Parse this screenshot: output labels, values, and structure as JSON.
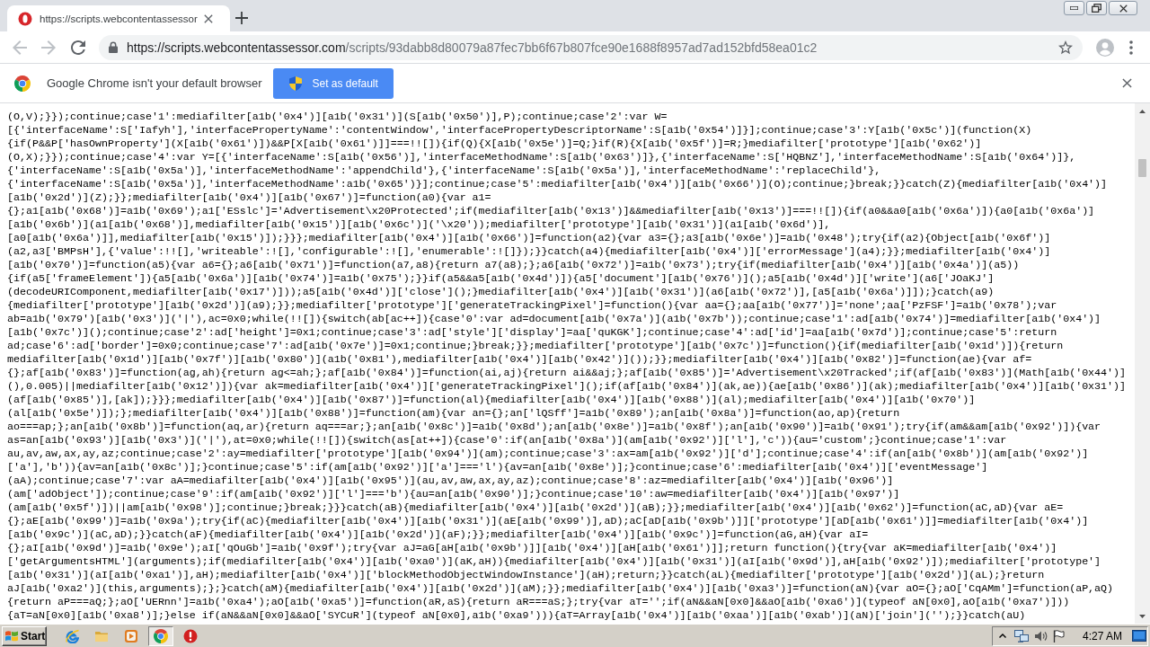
{
  "tabs": [
    {
      "title": "https://scripts.webcontentassessor",
      "selected": true
    }
  ],
  "toolbar": {
    "back": {
      "disabled": true
    },
    "forward": {
      "disabled": true
    },
    "url_host": "https://scripts.webcontentassessor.com",
    "url_path": "/scripts/93dabb8d80079a87fec7bb6f67b807fce90e1688f8957ad7ad152bfd58ea01c2"
  },
  "infobar": {
    "message": "Google Chrome isn't your default browser",
    "button": "Set as default"
  },
  "code_lines": [
    "(O,V);}});continue;case'1':mediafilter[a1b('0x4')][a1b('0x31')](S[a1b('0x50')],P);continue;case'2':var W=",
    "[{'interfaceName':S['Iafyh'],'interfacePropertyName':'contentWindow','interfacePropertyDescriptorName':S[a1b('0x54')]}];continue;case'3':Y[a1b('0x5c')](function(X)",
    "{if(P&&P['hasOwnProperty'](X[a1b('0x61')])&&P[X[a1b('0x61')]]===!![]){if(Q){X[a1b('0x5e')]=Q;}if(R){X[a1b('0x5f')]=R;}mediafilter['prototype'][a1b('0x62')]",
    "(O,X);}});continue;case'4':var Y=[{'interfaceName':S[a1b('0x56')],'interfaceMethodName':S[a1b('0x63')]},{'interfaceName':S['HQBNZ'],'interfaceMethodName':S[a1b('0x64')]},",
    "{'interfaceName':S[a1b('0x5a')],'interfaceMethodName':'appendChild'},{'interfaceName':S[a1b('0x5a')],'interfaceMethodName':'replaceChild'},",
    "{'interfaceName':S[a1b('0x5a')],'interfaceMethodName':a1b('0x65')}];continue;case'5':mediafilter[a1b('0x4')][a1b('0x66')](O);continue;}break;}}catch(Z){mediafilter[a1b('0x4')]",
    "[a1b('0x2d')](Z);}};mediafilter[a1b('0x4')][a1b('0x67')]=function(a0){var a1=",
    "{};a1[a1b('0x68')]=a1b('0x69');a1['ESslc']='Advertisement\\x20Protected';if(mediafilter[a1b('0x13')]&&mediafilter[a1b('0x13')]===!![]){if(a0&&a0[a1b('0x6a')]){a0[a1b('0x6a')]",
    "[a1b('0x6b')](a1[a1b('0x68')],mediafilter[a1b('0x15')][a1b('0x6c')]('\\x20'));mediafilter['prototype'][a1b('0x31')](a1[a1b('0x6d')],",
    "[a0[a1b('0x6a')]],mediafilter[a1b('0x15')]);}}};mediafilter[a1b('0x4')][a1b('0x66')]=function(a2){var a3={};a3[a1b('0x6e')]=a1b('0x48');try{if(a2){Object[a1b('0x6f')]",
    "(a2,a3['BMPsH'],{'value':!![],'writeable':![],'configurable':![],'enumerable':![]});}}catch(a4){mediafilter[a1b('0x4')]['errorMessage'](a4);}};mediafilter[a1b('0x4')]",
    "[a1b('0x70')]=function(a5){var a6={};a6[a1b('0x71')]=function(a7,a8){return a7(a8);};a6[a1b('0x72')]=a1b('0x73');try{if(mediafilter[a1b('0x4')][a1b('0x4a')](a5))",
    "{if(a5['frameElement']){a5[a1b('0x6a')][a1b('0x74')]=a1b('0x75');}}if(a5&&a5[a1b('0x4d')]){a5['document'][a1b('0x76')]();a5[a1b('0x4d')]['write'](a6['JOaKJ']",
    "(decodeURIComponent,mediafilter[a1b('0x17')]));a5[a1b('0x4d')]['close']();}mediafilter[a1b('0x4')][a1b('0x31')](a6[a1b('0x72')],[a5[a1b('0x6a')]]);}catch(a9)",
    "{mediafilter['prototype'][a1b('0x2d')](a9);}};mediafilter['prototype']['generateTrackingPixel']=function(){var aa={};aa[a1b('0x77')]='none';aa['PzFSF']=a1b('0x78');var",
    "ab=a1b('0x79')[a1b('0x3')]('|'),ac=0x0;while(!![]){switch(ab[ac++]){case'0':var ad=document[a1b('0x7a')](a1b('0x7b'));continue;case'1':ad[a1b('0x74')]=mediafilter[a1b('0x4')]",
    "[a1b('0x7c')]();continue;case'2':ad['height']=0x1;continue;case'3':ad['style']['display']=aa['quKGK'];continue;case'4':ad['id']=aa[a1b('0x7d')];continue;case'5':return",
    "ad;case'6':ad['border']=0x0;continue;case'7':ad[a1b('0x7e')]=0x1;continue;}break;}};mediafilter['prototype'][a1b('0x7c')]=function(){if(mediafilter[a1b('0x1d')]){return",
    "mediafilter[a1b('0x1d')][a1b('0x7f')][a1b('0x80')](a1b('0x81'),mediafilter[a1b('0x4')][a1b('0x42')]());}};mediafilter[a1b('0x4')][a1b('0x82')]=function(ae){var af=",
    "{};af[a1b('0x83')]=function(ag,ah){return ag<=ah;};af[a1b('0x84')]=function(ai,aj){return ai&&aj;};af[a1b('0x85')]='Advertisement\\x20Tracked';if(af[a1b('0x83')](Math[a1b('0x44')]",
    "(),0.005)||mediafilter[a1b('0x12')]){var ak=mediafilter[a1b('0x4')]['generateTrackingPixel']();if(af[a1b('0x84')](ak,ae)){ae[a1b('0x86')](ak);mediafilter[a1b('0x4')][a1b('0x31')]",
    "(af[a1b('0x85')],[ak]);}}};mediafilter[a1b('0x4')][a1b('0x87')]=function(al){mediafilter[a1b('0x4')][a1b('0x88')](al);mediafilter[a1b('0x4')][a1b('0x70')]",
    "(al[a1b('0x5e')]);};mediafilter[a1b('0x4')][a1b('0x88')]=function(am){var an={};an['lQSff']=a1b('0x89');an[a1b('0x8a')]=function(ao,ap){return",
    "ao===ap;};an[a1b('0x8b')]=function(aq,ar){return aq===ar;};an[a1b('0x8c')]=a1b('0x8d');an[a1b('0x8e')]=a1b('0x8f');an[a1b('0x90')]=a1b('0x91');try{if(am&&am[a1b('0x92')]){var",
    "as=an[a1b('0x93')][a1b('0x3')]('|'),at=0x0;while(!![]){switch(as[at++]){case'0':if(an[a1b('0x8a')](am[a1b('0x92')]['l'],'c')){au='custom';}continue;case'1':var",
    "au,av,aw,ax,ay,az;continue;case'2':ay=mediafilter['prototype'][a1b('0x94')](am);continue;case'3':ax=am[a1b('0x92')]['d'];continue;case'4':if(an[a1b('0x8b')](am[a1b('0x92')]",
    "['a'],'b')){av=an[a1b('0x8c')];}continue;case'5':if(am[a1b('0x92')]['a']==='l'){av=an[a1b('0x8e')];}continue;case'6':mediafilter[a1b('0x4')]['eventMessage']",
    "(aA);continue;case'7':var aA=mediafilter[a1b('0x4')][a1b('0x95')](au,av,aw,ax,ay,az);continue;case'8':az=mediafilter[a1b('0x4')][a1b('0x96')]",
    "(am['adObject']);continue;case'9':if(am[a1b('0x92')]['l']==='b'){au=an[a1b('0x90')];}continue;case'10':aw=mediafilter[a1b('0x4')][a1b('0x97')]",
    "(am[a1b('0x5f')])||am[a1b('0x98')];continue;}break;}}}catch(aB){mediafilter[a1b('0x4')][a1b('0x2d')](aB);}};mediafilter[a1b('0x4')][a1b('0x62')]=function(aC,aD){var aE=",
    "{};aE[a1b('0x99')]=a1b('0x9a');try{if(aC){mediafilter[a1b('0x4')][a1b('0x31')](aE[a1b('0x99')],aD);aC[aD[a1b('0x9b')]]['prototype'][aD[a1b('0x61')]]=mediafilter[a1b('0x4')]",
    "[a1b('0x9c')](aC,aD);}}catch(aF){mediafilter[a1b('0x4')][a1b('0x2d')](aF);}};mediafilter[a1b('0x4')][a1b('0x9c')]=function(aG,aH){var aI=",
    "{};aI[a1b('0x9d')]=a1b('0x9e');aI['qOuGb']=a1b('0x9f');try{var aJ=aG[aH[a1b('0x9b')]][a1b('0x4')][aH[a1b('0x61')]];return function(){try{var aK=mediafilter[a1b('0x4')]",
    "['getArgumentsHTML'](arguments);if(mediafilter[a1b('0x4')][a1b('0xa0')](aK,aH)){mediafilter[a1b('0x4')][a1b('0x31')](aI[a1b('0x9d')],aH[a1b('0x92')]);mediafilter['prototype']",
    "[a1b('0x31')](aI[a1b('0xa1')],aH);mediafilter[a1b('0x4')]['blockMethodObjectWindowInstance'](aH);return;}}catch(aL){mediafilter['prototype'][a1b('0x2d')](aL);}return",
    "aJ[a1b('0xa2')](this,arguments);};}catch(aM){mediafilter[a1b('0x4')][a1b('0x2d')](aM);}};mediafilter[a1b('0x4')][a1b('0xa3')]=function(aN){var aO={};aO['CqAMm']=function(aP,aQ)",
    "{return aP===aQ;};aO['UERnn']=a1b('0xa4');aO[a1b('0xa5')]=function(aR,aS){return aR===aS;};try{var aT='';if(aN&&aN[0x0]&&aO[a1b('0xa6')](typeof aN[0x0],aO[a1b('0xa7')]))",
    "{aT=aN[0x0][a1b('0xa8')];}else if(aN&&aN[0x0]&&aO['SYCuR'](typeof aN[0x0],a1b('0xa9'))){aT=Array[a1b('0x4')][a1b('0xaa')][a1b('0xab')](aN)['join']('');}}catch(aU)"
  ],
  "taskbar": {
    "start": "Start",
    "apps": [
      {
        "selected": false
      },
      {
        "selected": false
      },
      {
        "selected": false
      },
      {
        "selected": true
      },
      {
        "selected": false
      }
    ],
    "clock": "4:27 AM"
  }
}
